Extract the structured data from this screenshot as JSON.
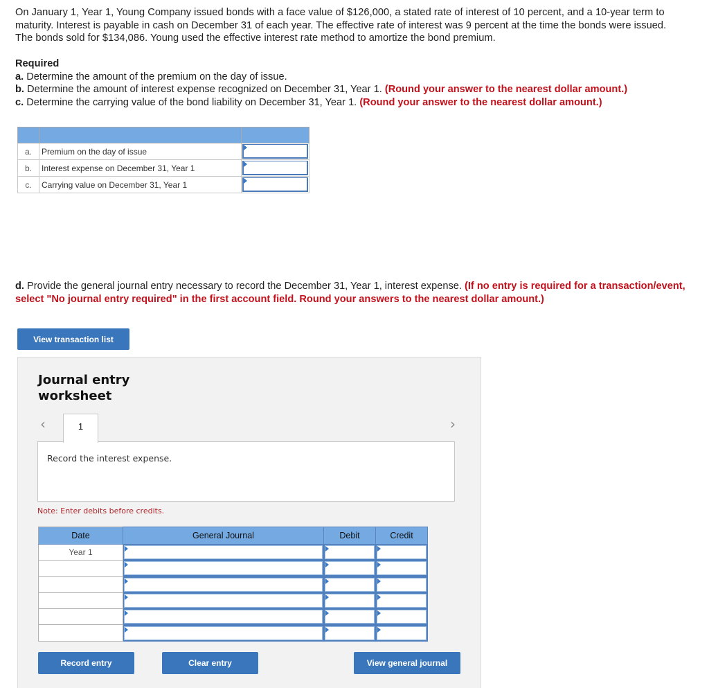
{
  "intro": "On January 1, Year 1, Young Company issued bonds with a face value of $126,000, a stated rate of interest of 10 percent, and a 10-year term to maturity. Interest is payable in cash on December 31 of each year. The effective rate of interest was 9 percent at the time the bonds were issued. The bonds sold for $134,086. Young used the effective interest rate method to amortize the bond premium.",
  "required": {
    "heading": "Required",
    "items": [
      {
        "letter": "a.",
        "text": "Determine the amount of the premium on the day of issue.",
        "note": ""
      },
      {
        "letter": "b.",
        "text": "Determine the amount of interest expense recognized on December 31, Year 1.",
        "note": "(Round your answer to the nearest dollar amount.)"
      },
      {
        "letter": "c.",
        "text": "Determine the carrying value of the bond liability on December 31, Year 1.",
        "note": "(Round your answer to the nearest dollar amount.)"
      }
    ]
  },
  "answer_table": {
    "rows": [
      {
        "letter": "a.",
        "label": "Premium on the day of issue",
        "value": ""
      },
      {
        "letter": "b.",
        "label": "Interest expense on December 31, Year 1",
        "value": ""
      },
      {
        "letter": "c.",
        "label": "Carrying value on December 31, Year 1",
        "value": ""
      }
    ]
  },
  "part_d": {
    "letter": "d.",
    "text": "Provide the general journal entry necessary to record the December 31, Year 1, interest expense.",
    "note": "(If no entry is required for a transaction/event, select \"No journal entry required\" in the first account field. Round your answers to the nearest dollar amount.)"
  },
  "buttons": {
    "view_transaction_list": "View transaction list",
    "record_entry": "Record entry",
    "clear_entry": "Clear entry",
    "view_general_journal": "View general journal"
  },
  "worksheet": {
    "title_line1": "Journal entry",
    "title_line2": "worksheet",
    "prev_icon": "‹",
    "next_icon": "›",
    "active_tab": "1",
    "description": "Record the interest expense.",
    "note": "Note: Enter debits before credits.",
    "columns": [
      "Date",
      "General Journal",
      "Debit",
      "Credit"
    ],
    "rows": [
      {
        "date": "Year 1",
        "account": "",
        "debit": "",
        "credit": ""
      },
      {
        "date": "",
        "account": "",
        "debit": "",
        "credit": ""
      },
      {
        "date": "",
        "account": "",
        "debit": "",
        "credit": ""
      },
      {
        "date": "",
        "account": "",
        "debit": "",
        "credit": ""
      },
      {
        "date": "",
        "account": "",
        "debit": "",
        "credit": ""
      },
      {
        "date": "",
        "account": "",
        "debit": "",
        "credit": ""
      }
    ]
  },
  "colors": {
    "accent": "#3a76bb",
    "header_blue": "#74a9e1",
    "instruction_red": "#c1121c"
  }
}
